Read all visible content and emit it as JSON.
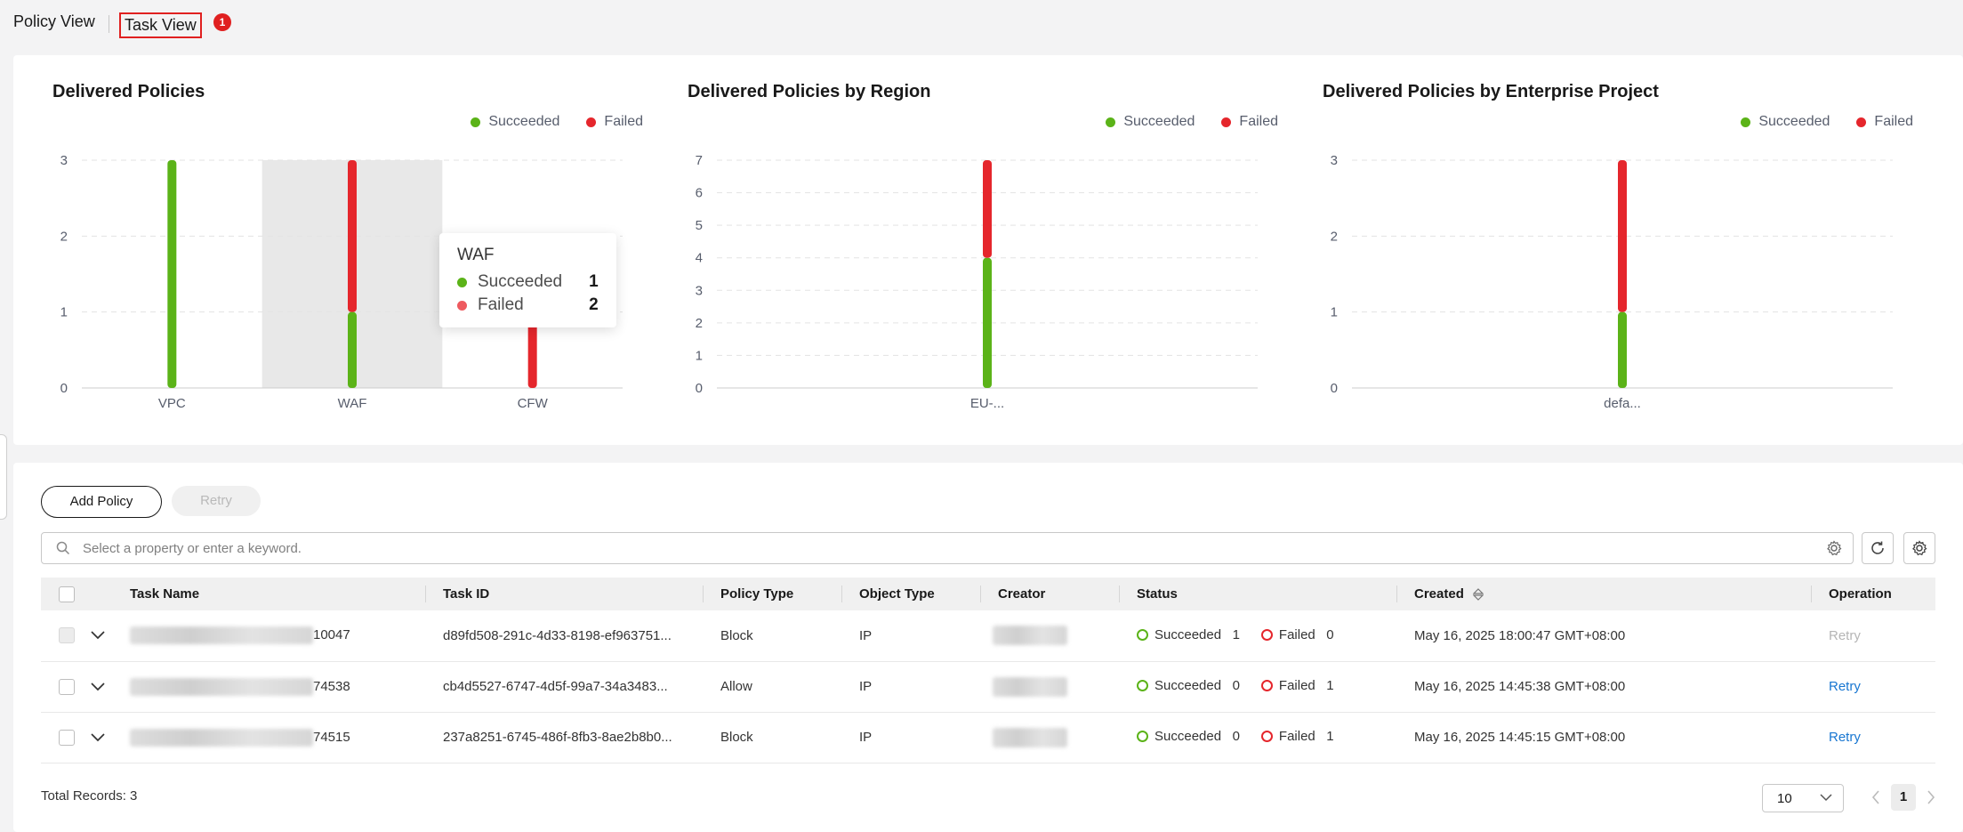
{
  "tabs": {
    "policy_view": "Policy View",
    "task_view": "Task View",
    "badge": "1"
  },
  "colors": {
    "succeeded": "#5bb318",
    "failed": "#e5262c",
    "link": "#1876d1"
  },
  "legend": {
    "succeeded": "Succeeded",
    "failed": "Failed"
  },
  "chart_data": [
    {
      "type": "bar",
      "stacked": true,
      "title": "Delivered Policies",
      "categories": [
        "VPC",
        "WAF",
        "CFW"
      ],
      "series": [
        {
          "name": "Succeeded",
          "values": [
            3,
            1,
            0
          ]
        },
        {
          "name": "Failed",
          "values": [
            0,
            2,
            1
          ]
        }
      ],
      "yticks": [
        0,
        1,
        2,
        3
      ],
      "ylim": [
        0,
        3
      ],
      "grid": true,
      "legend_position": "top-right",
      "highlight_category": "WAF",
      "tooltip": {
        "title": "WAF",
        "rows": [
          {
            "label": "Succeeded",
            "value": "1"
          },
          {
            "label": "Failed",
            "value": "2"
          }
        ]
      }
    },
    {
      "type": "bar",
      "stacked": true,
      "title": "Delivered Policies by Region",
      "categories": [
        "EU-..."
      ],
      "series": [
        {
          "name": "Succeeded",
          "values": [
            4
          ]
        },
        {
          "name": "Failed",
          "values": [
            3
          ]
        }
      ],
      "yticks": [
        0,
        1,
        2,
        3,
        4,
        5,
        6,
        7
      ],
      "ylim": [
        0,
        7
      ],
      "grid": true,
      "legend_position": "top-right"
    },
    {
      "type": "bar",
      "stacked": true,
      "title": "Delivered Policies by Enterprise Project",
      "categories": [
        "defa..."
      ],
      "series": [
        {
          "name": "Succeeded",
          "values": [
            1
          ]
        },
        {
          "name": "Failed",
          "values": [
            2
          ]
        }
      ],
      "yticks": [
        0,
        1,
        2,
        3
      ],
      "ylim": [
        0,
        3
      ],
      "grid": true,
      "legend_position": "top-right"
    }
  ],
  "toolbar": {
    "add_policy": "Add Policy",
    "retry": "Retry"
  },
  "search": {
    "placeholder": "Select a property or enter a keyword."
  },
  "table": {
    "columns": [
      "Task Name",
      "Task ID",
      "Policy Type",
      "Object Type",
      "Creator",
      "Status",
      "Created",
      "Operation"
    ],
    "rows": [
      {
        "task_name_suffix": "10047",
        "task_id": "d89fd508-291c-4d33-8198-ef963751...",
        "policy_type": "Block",
        "object_type": "IP",
        "status_succeeded_label": "Succeeded",
        "succeeded": "1",
        "status_failed_label": "Failed",
        "failed": "0",
        "created": "May 16, 2025 18:00:47 GMT+08:00",
        "operation": "Retry",
        "operation_enabled": false
      },
      {
        "task_name_suffix": "74538",
        "task_id": "cb4d5527-6747-4d5f-99a7-34a3483...",
        "policy_type": "Allow",
        "object_type": "IP",
        "status_succeeded_label": "Succeeded",
        "succeeded": "0",
        "status_failed_label": "Failed",
        "failed": "1",
        "created": "May 16, 2025 14:45:38 GMT+08:00",
        "operation": "Retry",
        "operation_enabled": true
      },
      {
        "task_name_suffix": "74515",
        "task_id": "237a8251-6745-486f-8fb3-8ae2b8b0...",
        "policy_type": "Block",
        "object_type": "IP",
        "status_succeeded_label": "Succeeded",
        "succeeded": "0",
        "status_failed_label": "Failed",
        "failed": "1",
        "created": "May 16, 2025 14:45:15 GMT+08:00",
        "operation": "Retry",
        "operation_enabled": true
      }
    ]
  },
  "footer": {
    "total_records": "Total Records: 3",
    "page_size": "10",
    "current_page": "1"
  }
}
